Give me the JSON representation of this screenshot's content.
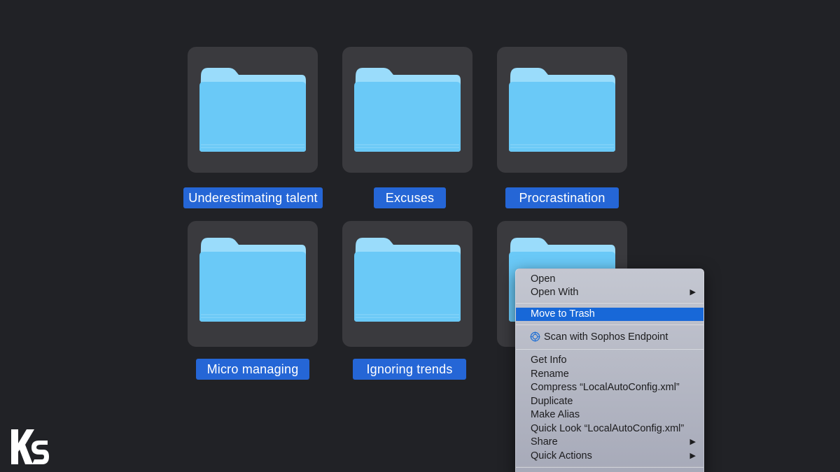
{
  "folders": [
    {
      "label": "Underestimating talent"
    },
    {
      "label": "Excuses"
    },
    {
      "label": "Procrastination"
    },
    {
      "label": "Micro managing"
    },
    {
      "label": "Ignoring trends"
    },
    {
      "label": ""
    }
  ],
  "context_menu": {
    "open": "Open",
    "open_with": "Open With",
    "move_to_trash": "Move to Trash",
    "scan_sophos": "Scan with Sophos Endpoint",
    "get_info": "Get Info",
    "rename": "Rename",
    "compress": "Compress “LocalAutoConfig.xml”",
    "duplicate": "Duplicate",
    "make_alias": "Make Alias",
    "quick_look": "Quick Look “LocalAutoConfig.xml”",
    "share": "Share",
    "quick_actions": "Quick Actions",
    "submenu_arrow": "▶"
  },
  "icons": {
    "folder": "folder-icon",
    "sophos": "sophos-shield-icon",
    "logo": "ks-logo"
  },
  "colors": {
    "background": "#212226",
    "tile": "#3a3a3e",
    "label": "#2566d6",
    "menu_highlight": "#1868d8",
    "folder_front": "#6ac9f7",
    "folder_back": "#9adcfb"
  }
}
